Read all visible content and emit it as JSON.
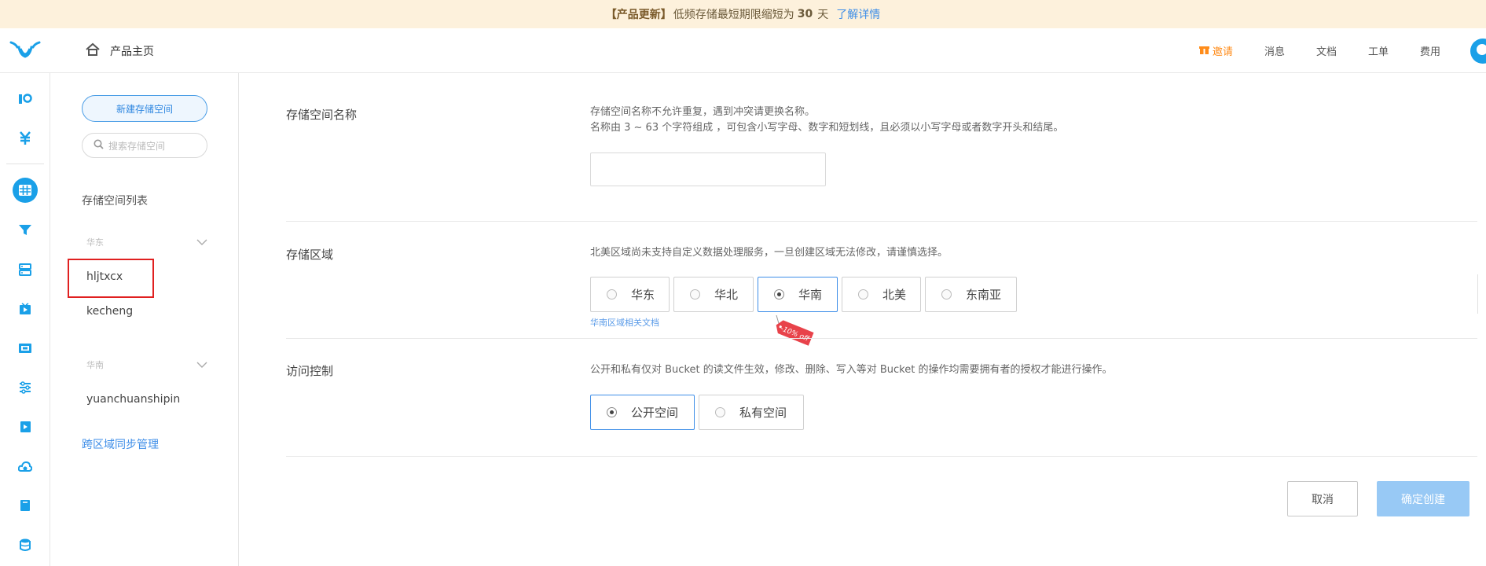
{
  "notice": {
    "bracket_text": "【产品更新】",
    "text_before": "低频存储最短期限缩短为",
    "days": "30",
    "text_after": "天",
    "link": "了解详情"
  },
  "header": {
    "home_label": "产品主页",
    "nav": [
      "邀请",
      "消息",
      "文档",
      "工单",
      "费用"
    ]
  },
  "rail_icons": [
    "dashboard-icon",
    "billing-icon",
    "storage-icon",
    "cdn-icon",
    "host-icon",
    "live-icon",
    "media-icon",
    "data-process-icon",
    "video-icon",
    "cloud-icon",
    "notes-icon",
    "database-icon"
  ],
  "sidebar": {
    "new_bucket": "新建存储空间",
    "search_placeholder": "搜索存储空间",
    "list_title": "存储空间列表",
    "groups": [
      {
        "name": "华东",
        "buckets": [
          "hljtxcx",
          "kecheng"
        ]
      },
      {
        "name": "华南",
        "buckets": [
          "yuanchuanshipin"
        ]
      }
    ],
    "cross_region": "跨区域同步管理"
  },
  "form": {
    "name_label": "存储空间名称",
    "name_desc_1": "存储空间名称不允许重复，遇到冲突请更换名称。",
    "name_desc_2": "名称由 3 ~ 63 个字符组成 ，可包含小写字母、数字和短划线，且必须以小写字母或者数字开头和结尾。",
    "name_value": "",
    "region_label": "存储区域",
    "region_desc": "北美区域尚未支持自定义数据处理服务，一旦创建区域无法修改，请谨慎选择。",
    "regions": [
      "华东",
      "华北",
      "华南",
      "北美",
      "东南亚"
    ],
    "region_selected": "华南",
    "region_doc_link": "华南区域相关文档",
    "discount_tag": "-10% off",
    "access_label": "访问控制",
    "access_desc": "公开和私有仅对 Bucket 的读文件生效，修改、删除、写入等对 Bucket 的操作均需要拥有者的授权才能进行操作。",
    "access_options": [
      "公开空间",
      "私有空间"
    ],
    "access_selected": "公开空间",
    "cancel": "取消",
    "confirm": "确定创建"
  },
  "colors": {
    "accent": "#1aa0e8",
    "link": "#3e8ee8",
    "notice_bg": "#fdf1dc",
    "confirm_disabled": "#98c9f5",
    "highlight": "#e02020",
    "tag": "#e8424a"
  }
}
